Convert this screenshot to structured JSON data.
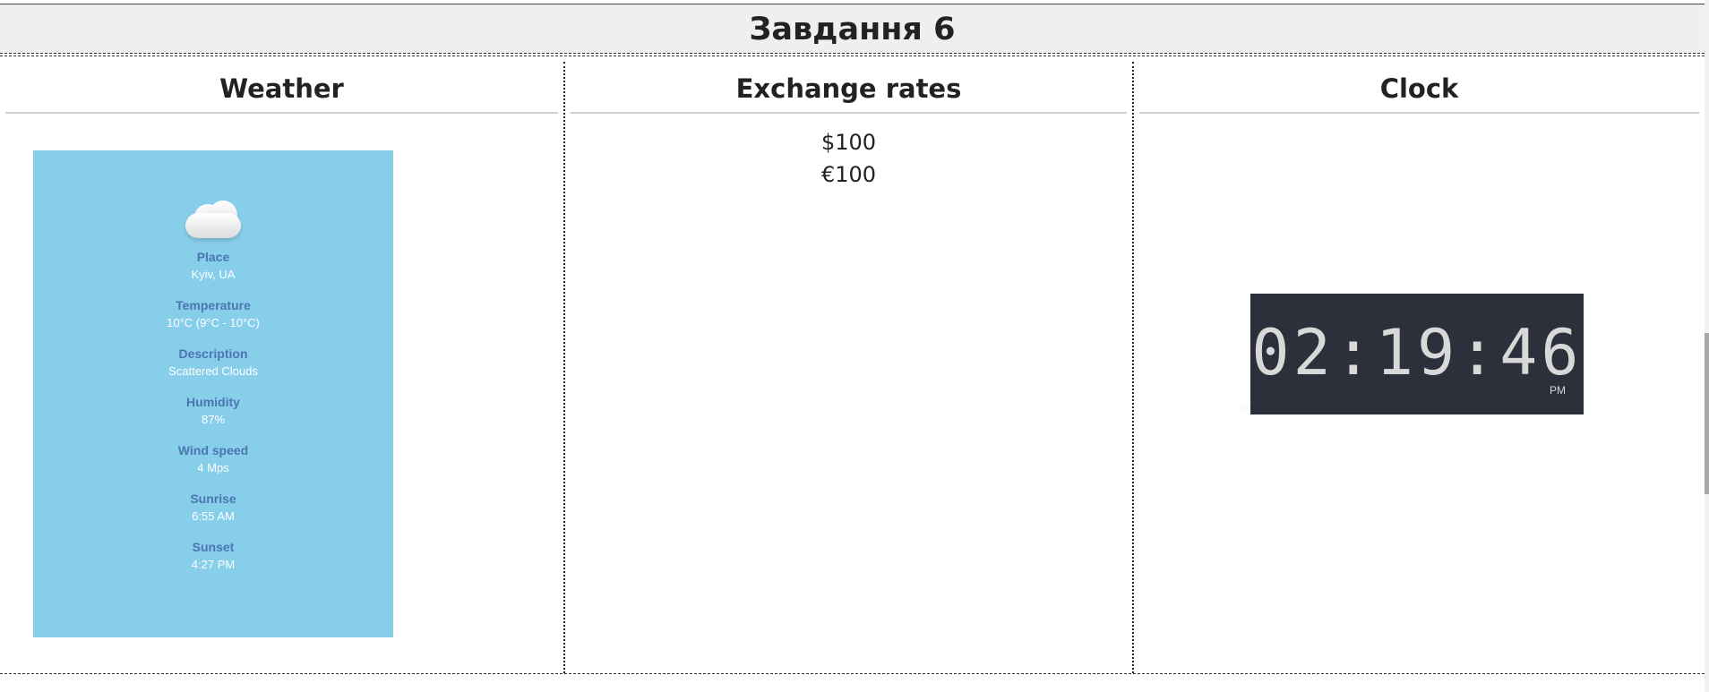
{
  "task": {
    "title": "Завдання 6"
  },
  "weather": {
    "title": "Weather",
    "icon": "cloud-icon",
    "fields": [
      {
        "label": "Place",
        "value": "Kyiv, UA"
      },
      {
        "label": "Temperature",
        "value": "10°C (9°C - 10°C)"
      },
      {
        "label": "Description",
        "value": "Scattered Clouds"
      },
      {
        "label": "Humidity",
        "value": "87%"
      },
      {
        "label": "Wind speed",
        "value": "4 Mps"
      },
      {
        "label": "Sunrise",
        "value": "6:55 AM"
      },
      {
        "label": "Sunset",
        "value": "4:27 PM"
      }
    ],
    "card_color": "#87ceeb",
    "label_color": "#4a76b0"
  },
  "rates": {
    "title": "Exchange rates",
    "items": [
      "$100",
      "€100"
    ]
  },
  "clock": {
    "title": "Clock",
    "time": "02:19:46",
    "ampm": "PM",
    "face_color": "#2b303a"
  }
}
